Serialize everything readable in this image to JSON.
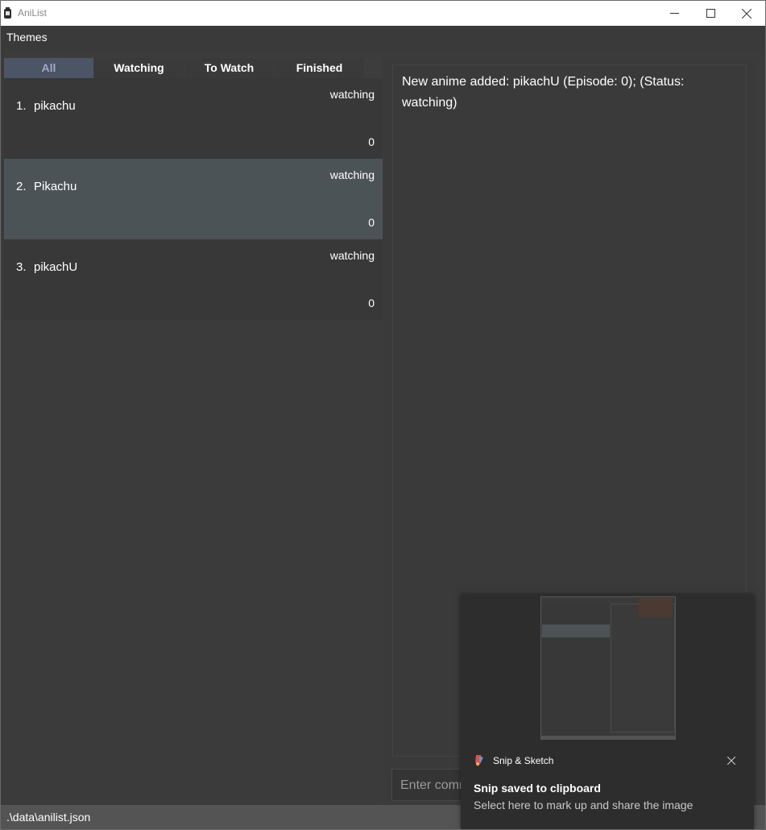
{
  "window": {
    "title": "AniList"
  },
  "menu": {
    "items": [
      {
        "label": "Themes"
      }
    ]
  },
  "tabs": [
    {
      "label": "All",
      "active": true
    },
    {
      "label": "Watching",
      "active": false
    },
    {
      "label": "To Watch",
      "active": false
    },
    {
      "label": "Finished",
      "active": false
    }
  ],
  "anime_list": [
    {
      "index": "1.",
      "name": "pikachu",
      "status": "watching",
      "episode": "0"
    },
    {
      "index": "2.",
      "name": "Pikachu",
      "status": "watching",
      "episode": "0",
      "selected": true
    },
    {
      "index": "3.",
      "name": "pikachU",
      "status": "watching",
      "episode": "0"
    }
  ],
  "result": {
    "text": "New anime added: pikachU (Episode: 0); (Status: watching)"
  },
  "command": {
    "placeholder": "Enter command here...",
    "value": ""
  },
  "statusbar": {
    "path": ".\\data\\anilist.json"
  },
  "toast": {
    "app_name": "Snip & Sketch",
    "title": "Snip saved to clipboard",
    "body": "Select here to mark up and share the image"
  },
  "colors": {
    "background": "#3b3b3b",
    "tab_active_bg": "#4b5566",
    "tab_active_text": "#a9a3c9",
    "selected_card": "#4c5357",
    "statusbar": "#545454",
    "toast_bg": "#2d2d2d"
  },
  "icons": {
    "app": "anilist-app-icon",
    "minimize": "minimize-icon",
    "maximize": "maximize-icon",
    "close": "close-icon",
    "snip": "snip-sketch-icon"
  }
}
